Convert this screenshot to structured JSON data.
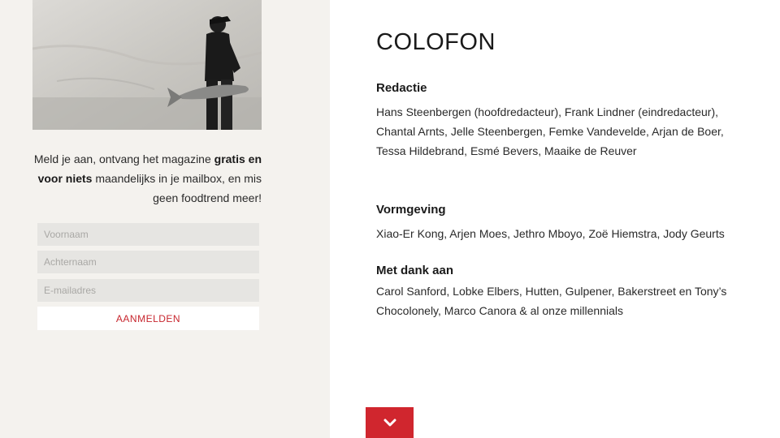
{
  "sidebar": {
    "photo_alt": "photo-of-chef-carrying-fish",
    "promo": {
      "text1": "Meld je aan, ontvang het magazine ",
      "bold": "gratis en voor niets",
      "text2": " maandelijks in je mailbox, en mis geen foodtrend meer!"
    },
    "form": {
      "firstname_placeholder": "Voornaam",
      "lastname_placeholder": "Achternaam",
      "email_placeholder": "E-mailadres",
      "submit_label": "AANMELDEN"
    }
  },
  "main": {
    "title": "COLOFON",
    "sections": [
      {
        "heading": "Redactie",
        "body": "Hans Steenbergen (hoofdredacteur), Frank Lindner (eindredacteur), Chantal Arnts, Jelle Steenbergen, Femke Vandevelde, Arjan de Boer, Tessa Hildebrand, Esmé Bevers, Maaike de Reuver"
      },
      {
        "heading": "Vormgeving",
        "body": "Xiao-Er Kong, Arjen Moes, Jethro Mboyo, Zoë Hiemstra, Jody Geurts"
      },
      {
        "heading": "Met dank aan",
        "body": "Carol Sanford, Lobke Elbers, Hutten, Gulpener, Bakerstreet en Tony’s Chocolonely, Marco Canora & al onze millennials"
      }
    ]
  },
  "scroll_button": {
    "icon": "chevron-down-icon"
  },
  "colors": {
    "accent": "#d0262e",
    "sidebar_bg": "#f4f2ee",
    "field_bg": "#e6e5e2"
  }
}
